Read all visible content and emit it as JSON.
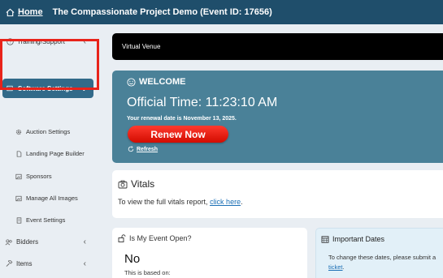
{
  "topbar": {
    "home_label": "Home",
    "event_title": "The Compassionate Project Demo (Event ID: 17656)"
  },
  "sidebar": {
    "training_support": "Training/Support",
    "software_settings": "Software Settings",
    "sub_items": [
      "Auction Settings",
      "Landing Page Builder",
      "Sponsors",
      "Manage All Images",
      "Event Settings"
    ],
    "bidders": "Bidders",
    "items": "Items"
  },
  "venue": {
    "label": "Virtual Venue"
  },
  "welcome": {
    "heading": "WELCOME",
    "official_time": "Official Time: 11:23:10 AM",
    "renewal_text": "Your renewal date is November 13, 2025.",
    "renew_button": "Renew Now",
    "refresh_label": "Refresh"
  },
  "vitals": {
    "heading": "Vitals",
    "body_text": "To view the full vitals report,",
    "link_text": "click here",
    "period": "."
  },
  "event_open": {
    "heading": "Is My Event Open?",
    "value": "No",
    "sub_text": "This is based on:"
  },
  "important_dates": {
    "heading": "Important Dates",
    "body_text": "To change these dates, please submit a",
    "link_text": "ticket",
    "period": "."
  },
  "colors": {
    "topbar": "#1f4e6b",
    "active_item": "#326a89",
    "welcome_panel": "#4a8198",
    "renew_button": "#e8150a",
    "highlight_box": "#e8231a",
    "link": "#1b6fb5"
  }
}
